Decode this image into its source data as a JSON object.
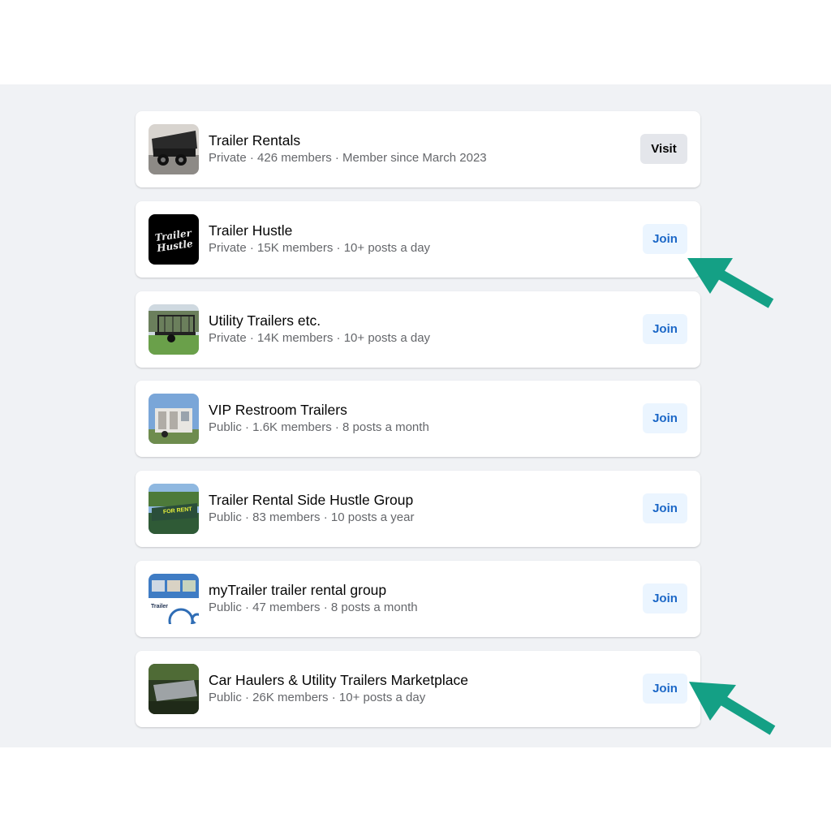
{
  "groups": [
    {
      "name": "Trailer Rentals",
      "meta": "Private · 426 members · Member since March 2023",
      "action": "Visit"
    },
    {
      "name": "Trailer Hustle",
      "meta": "Private · 15K members · 10+ posts a day",
      "action": "Join",
      "thumb_text_1": "Trailer",
      "thumb_text_2": "Hustle"
    },
    {
      "name": "Utility Trailers etc.",
      "meta": "Private · 14K members · 10+ posts a day",
      "action": "Join"
    },
    {
      "name": "VIP Restroom Trailers",
      "meta": "Public · 1.6K members · 8 posts a month",
      "action": "Join"
    },
    {
      "name": "Trailer Rental Side Hustle Group",
      "meta": "Public · 83 members · 10 posts a year",
      "action": "Join",
      "thumb_text": "FOR RENT"
    },
    {
      "name": "myTrailer trailer rental group",
      "meta": "Public · 47 members · 8 posts a month",
      "action": "Join",
      "thumb_text": "Trailer"
    },
    {
      "name": "Car Haulers & Utility Trailers Marketplace",
      "meta": "Public · 26K members · 10+ posts a day",
      "action": "Join"
    }
  ],
  "colors": {
    "background_band": "#f0f2f5",
    "join_button_bg": "#ebf5ff",
    "join_button_text": "#1b67c7",
    "visit_button_bg": "#e4e6eb",
    "annotation_arrow": "#14a085"
  },
  "annotations": [
    {
      "icon": "arrow-pointer-icon",
      "points_to": "Trailer Hustle join button"
    },
    {
      "icon": "arrow-pointer-icon",
      "points_to": "Car Haulers & Utility Trailers Marketplace join button"
    }
  ]
}
